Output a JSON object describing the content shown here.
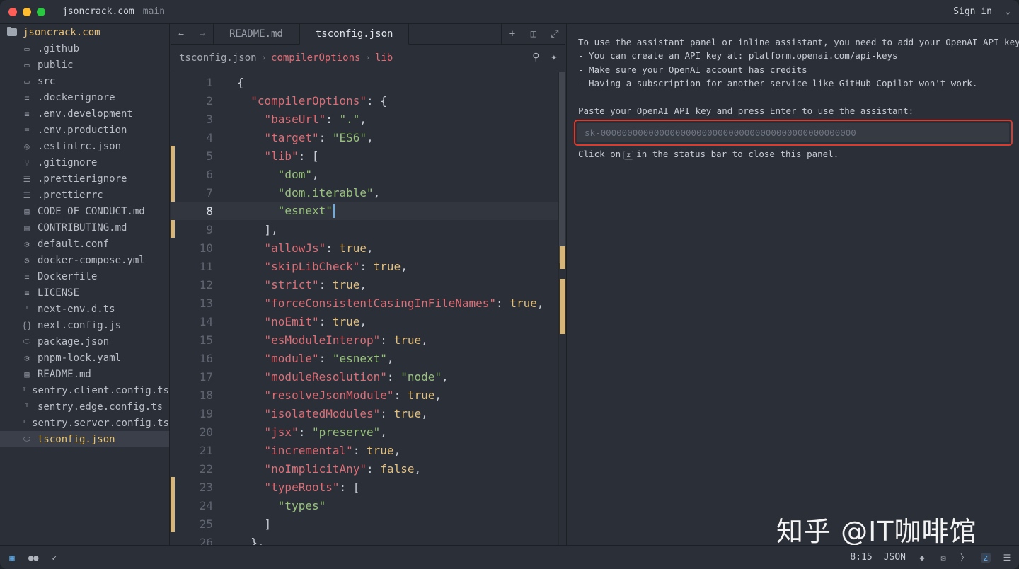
{
  "titlebar": {
    "project": "jsoncrack.com",
    "branch": "main",
    "signin": "Sign in"
  },
  "sidebar": {
    "root": "jsoncrack.com",
    "items": [
      {
        "name": ".github",
        "icon": "folder-icon"
      },
      {
        "name": "public",
        "icon": "folder-icon"
      },
      {
        "name": "src",
        "icon": "folder-icon"
      },
      {
        "name": ".dockerignore",
        "icon": "text-file-icon"
      },
      {
        "name": ".env.development",
        "icon": "text-file-icon"
      },
      {
        "name": ".env.production",
        "icon": "text-file-icon"
      },
      {
        "name": ".eslintrc.json",
        "icon": "eslint-icon"
      },
      {
        "name": ".gitignore",
        "icon": "git-icon"
      },
      {
        "name": ".prettierignore",
        "icon": "prettier-icon"
      },
      {
        "name": ".prettierrc",
        "icon": "prettier-icon"
      },
      {
        "name": "CODE_OF_CONDUCT.md",
        "icon": "book-icon"
      },
      {
        "name": "CONTRIBUTING.md",
        "icon": "book-icon"
      },
      {
        "name": "default.conf",
        "icon": "gear-icon"
      },
      {
        "name": "docker-compose.yml",
        "icon": "gear-icon"
      },
      {
        "name": "Dockerfile",
        "icon": "text-file-icon"
      },
      {
        "name": "LICENSE",
        "icon": "text-file-icon"
      },
      {
        "name": "next-env.d.ts",
        "icon": "typescript-icon"
      },
      {
        "name": "next.config.js",
        "icon": "braces-icon"
      },
      {
        "name": "package.json",
        "icon": "database-icon"
      },
      {
        "name": "pnpm-lock.yaml",
        "icon": "gear-icon"
      },
      {
        "name": "README.md",
        "icon": "book-icon"
      },
      {
        "name": "sentry.client.config.ts",
        "icon": "typescript-icon"
      },
      {
        "name": "sentry.edge.config.ts",
        "icon": "typescript-icon"
      },
      {
        "name": "sentry.server.config.ts",
        "icon": "typescript-icon"
      },
      {
        "name": "tsconfig.json",
        "icon": "database-icon",
        "selected": true
      }
    ]
  },
  "editor": {
    "tabs": [
      {
        "label": "README.md",
        "active": false
      },
      {
        "label": "tsconfig.json",
        "active": true
      }
    ],
    "breadcrumb": {
      "file": "tsconfig.json",
      "path": [
        "compilerOptions",
        "lib"
      ]
    },
    "current_line": 8,
    "lines": [
      {
        "n": "1",
        "t": [
          [
            "p",
            "{"
          ]
        ]
      },
      {
        "n": "2",
        "t": [
          [
            "p",
            "  "
          ],
          [
            "k",
            "\"compilerOptions\""
          ],
          [
            "p",
            ": {"
          ]
        ]
      },
      {
        "n": "3",
        "t": [
          [
            "p",
            "    "
          ],
          [
            "k",
            "\"baseUrl\""
          ],
          [
            "p",
            ": "
          ],
          [
            "s",
            "\".\""
          ],
          [
            "p",
            ","
          ]
        ]
      },
      {
        "n": "4",
        "t": [
          [
            "p",
            "    "
          ],
          [
            "k",
            "\"target\""
          ],
          [
            "p",
            ": "
          ],
          [
            "s",
            "\"ES6\""
          ],
          [
            "p",
            ","
          ]
        ]
      },
      {
        "n": "5",
        "t": [
          [
            "p",
            "    "
          ],
          [
            "k",
            "\"lib\""
          ],
          [
            "p",
            ": ["
          ]
        ]
      },
      {
        "n": "6",
        "t": [
          [
            "p",
            "      "
          ],
          [
            "s",
            "\"dom\""
          ],
          [
            "p",
            ","
          ]
        ]
      },
      {
        "n": "7",
        "t": [
          [
            "p",
            "      "
          ],
          [
            "s",
            "\"dom.iterable\""
          ],
          [
            "p",
            ","
          ]
        ]
      },
      {
        "n": "8",
        "t": [
          [
            "p",
            "      "
          ],
          [
            "s",
            "\"esnext\""
          ]
        ]
      },
      {
        "n": "9",
        "t": [
          [
            "p",
            "    ],"
          ]
        ]
      },
      {
        "n": "10",
        "t": [
          [
            "p",
            "    "
          ],
          [
            "k",
            "\"allowJs\""
          ],
          [
            "p",
            ": "
          ],
          [
            "b",
            "true"
          ],
          [
            "p",
            ","
          ]
        ]
      },
      {
        "n": "11",
        "t": [
          [
            "p",
            "    "
          ],
          [
            "k",
            "\"skipLibCheck\""
          ],
          [
            "p",
            ": "
          ],
          [
            "b",
            "true"
          ],
          [
            "p",
            ","
          ]
        ]
      },
      {
        "n": "12",
        "t": [
          [
            "p",
            "    "
          ],
          [
            "k",
            "\"strict\""
          ],
          [
            "p",
            ": "
          ],
          [
            "b",
            "true"
          ],
          [
            "p",
            ","
          ]
        ]
      },
      {
        "n": "13",
        "t": [
          [
            "p",
            "    "
          ],
          [
            "k",
            "\"forceConsistentCasingInFileNames\""
          ],
          [
            "p",
            ": "
          ],
          [
            "b",
            "true"
          ],
          [
            "p",
            ","
          ]
        ]
      },
      {
        "n": "14",
        "t": [
          [
            "p",
            "    "
          ],
          [
            "k",
            "\"noEmit\""
          ],
          [
            "p",
            ": "
          ],
          [
            "b",
            "true"
          ],
          [
            "p",
            ","
          ]
        ]
      },
      {
        "n": "15",
        "t": [
          [
            "p",
            "    "
          ],
          [
            "k",
            "\"esModuleInterop\""
          ],
          [
            "p",
            ": "
          ],
          [
            "b",
            "true"
          ],
          [
            "p",
            ","
          ]
        ]
      },
      {
        "n": "16",
        "t": [
          [
            "p",
            "    "
          ],
          [
            "k",
            "\"module\""
          ],
          [
            "p",
            ": "
          ],
          [
            "s",
            "\"esnext\""
          ],
          [
            "p",
            ","
          ]
        ]
      },
      {
        "n": "17",
        "t": [
          [
            "p",
            "    "
          ],
          [
            "k",
            "\"moduleResolution\""
          ],
          [
            "p",
            ": "
          ],
          [
            "s",
            "\"node\""
          ],
          [
            "p",
            ","
          ]
        ]
      },
      {
        "n": "18",
        "t": [
          [
            "p",
            "    "
          ],
          [
            "k",
            "\"resolveJsonModule\""
          ],
          [
            "p",
            ": "
          ],
          [
            "b",
            "true"
          ],
          [
            "p",
            ","
          ]
        ]
      },
      {
        "n": "19",
        "t": [
          [
            "p",
            "    "
          ],
          [
            "k",
            "\"isolatedModules\""
          ],
          [
            "p",
            ": "
          ],
          [
            "b",
            "true"
          ],
          [
            "p",
            ","
          ]
        ]
      },
      {
        "n": "20",
        "t": [
          [
            "p",
            "    "
          ],
          [
            "k",
            "\"jsx\""
          ],
          [
            "p",
            ": "
          ],
          [
            "s",
            "\"preserve\""
          ],
          [
            "p",
            ","
          ]
        ]
      },
      {
        "n": "21",
        "t": [
          [
            "p",
            "    "
          ],
          [
            "k",
            "\"incremental\""
          ],
          [
            "p",
            ": "
          ],
          [
            "b",
            "true"
          ],
          [
            "p",
            ","
          ]
        ]
      },
      {
        "n": "22",
        "t": [
          [
            "p",
            "    "
          ],
          [
            "k",
            "\"noImplicitAny\""
          ],
          [
            "p",
            ": "
          ],
          [
            "b",
            "false"
          ],
          [
            "p",
            ","
          ]
        ]
      },
      {
        "n": "23",
        "t": [
          [
            "p",
            "    "
          ],
          [
            "k",
            "\"typeRoots\""
          ],
          [
            "p",
            ": ["
          ]
        ]
      },
      {
        "n": "24",
        "t": [
          [
            "p",
            "      "
          ],
          [
            "s",
            "\"types\""
          ]
        ]
      },
      {
        "n": "25",
        "t": [
          [
            "p",
            "    ]"
          ]
        ]
      },
      {
        "n": "26",
        "t": [
          [
            "p",
            "  },"
          ]
        ]
      }
    ]
  },
  "assistant": {
    "intro": "To use the assistant panel or inline assistant, you need to add your OpenAI API key.",
    "bullets": [
      " - You can create an API key at: platform.openai.com/api-keys",
      " - Make sure your OpenAI account has credits",
      " - Having a subscription for another service like GitHub Copilot won't work."
    ],
    "prompt": "Paste your OpenAI API key and press Enter to use the assistant:",
    "placeholder": "sk-000000000000000000000000000000000000000000000000",
    "close_before": "Click on",
    "close_key": "z",
    "close_after": "in the status bar to close this panel.",
    "watermark": "知乎 @IT咖啡馆"
  },
  "statusbar": {
    "position": "8:15",
    "language": "JSON"
  },
  "colors": {
    "string": "#98c379",
    "key": "#e06c75",
    "boolean": "#e5c07b",
    "highlight_border": "#e0392b",
    "git_modified": "#d7b779"
  }
}
